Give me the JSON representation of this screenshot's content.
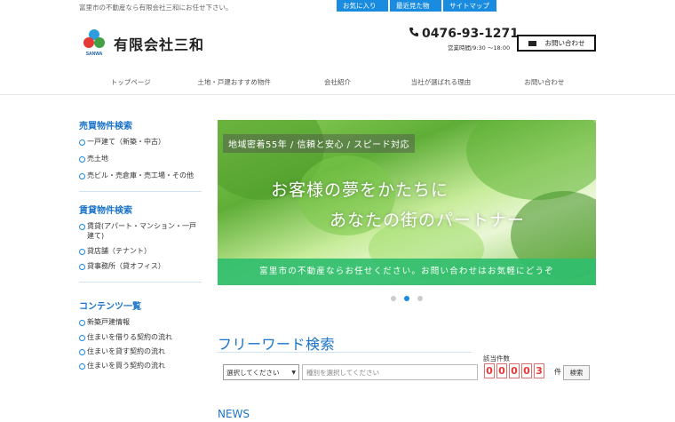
{
  "header": {
    "tagline": "富里市の不動産なら有限会社三和にお任せ下さい。",
    "top_links": [
      "お気に入り物件",
      "最近見た物件",
      "サイトマップ"
    ],
    "logo_text": "SANWA",
    "company": "有限会社三和",
    "phone": "0476-93-1271",
    "hours": "営業時間/9:30 〜18:00",
    "contact_button": "お問い合わせ"
  },
  "nav": [
    "トップページ",
    "土地・戸建おすすめ物件",
    "会社紹介",
    "当社が選ばれる理由",
    "お問い合わせ"
  ],
  "sidebar": {
    "sale_title": "売買物件検索",
    "sale_items": [
      "一戸建て（新築・中古）",
      "売土地",
      "売ビル・売倉庫・売工場・その他"
    ],
    "rent_title": "賃貸物件検索",
    "rent_items": [
      "賃貸(アパート・マンション・一戸建て)",
      "貸店舗（テナント）",
      "貸事務所（貸オフィス）"
    ],
    "content_title": "コンテンツ一覧",
    "content_items": [
      "新築戸建情報",
      "住まいを借りる契約の流れ",
      "住まいを貸す契約の流れ",
      "住まいを買う契約の流れ"
    ]
  },
  "hero": {
    "tag": "地域密着55年 / 信頼と安心 / スピード対応",
    "line1": "お客様の夢をかたちに",
    "line2": "あなたの街のパートナー",
    "band": "富里市の不動産ならお任せください。お問い合わせはお気軽にどうぞ",
    "active_slide": 2,
    "slide_count": 3
  },
  "freeword": {
    "title": "フリーワード検索",
    "select_value": "選択してください",
    "input_placeholder": "種別を選択してください",
    "count_label": "該当件数",
    "count_digits": [
      "0",
      "0",
      "0",
      "0",
      "3"
    ],
    "count_unit": "件",
    "search_button": "検索"
  },
  "news_title": "NEWS",
  "colors": {
    "accent": "#1a8ce0",
    "heading": "#1a73c9",
    "band": "#30be6e",
    "digit": "#e53935"
  }
}
